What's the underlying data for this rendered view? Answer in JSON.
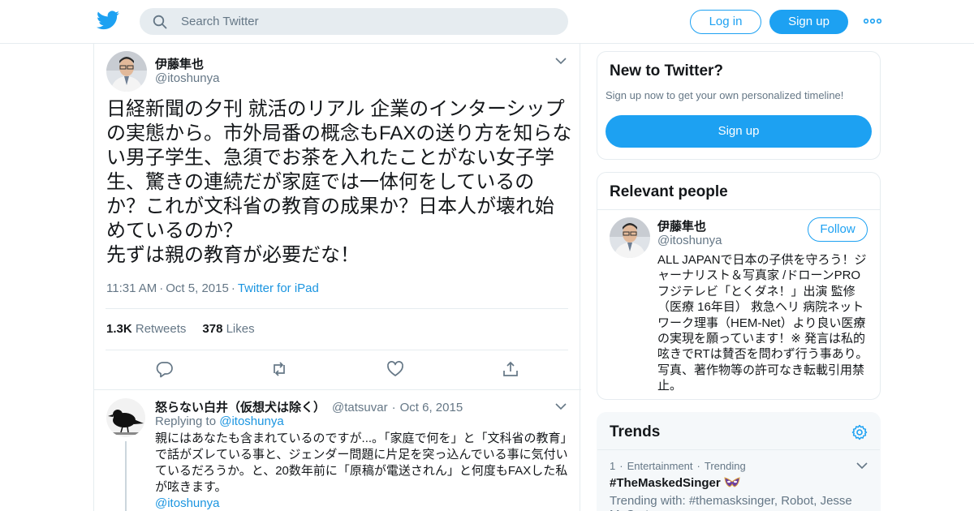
{
  "header": {
    "search_placeholder": "Search Twitter",
    "login_label": "Log in",
    "signup_label": "Sign up"
  },
  "tweet": {
    "name": "伊藤隼也",
    "handle": "@itoshunya",
    "text": "日経新聞の夕刊 就活のリアル 企業のインターシップの実態から。市外局番の概念もFAXの送り方を知らない男子学生、急須でお茶を入れたことがない女子学生、驚きの連続だが家庭では一体何をしているのか？これが文科省の教育の成果か？日本人が壊れ始めているのか？\n先ずは親の教育が必要だな！",
    "time": "11:31 AM",
    "date": "Oct 5, 2015",
    "source": "Twitter for iPad",
    "retweets_count": "1.3K",
    "retweets_label": "Retweets",
    "likes_count": "378",
    "likes_label": "Likes"
  },
  "reply": {
    "name": "怒らない白井（仮想犬は除く）",
    "handle": "@tatsuvar",
    "date": "Oct 6, 2015",
    "replying_prefix": "Replying to",
    "replying_to": "@itoshunya",
    "text": "親にはあなたも含まれているのですが...。「家庭で何を」と「文科省の教育」で話がズレている事と、ジェンダー問題に片足を突っ込んでいる事に気付いているだろうか。と、20数年前に「原稿が電送されん」と何度もFAXした私が呟きます。",
    "mention": "@itoshunya"
  },
  "sidebar": {
    "new_title": "New to Twitter?",
    "new_sub": "Sign up now to get your own personalized timeline!",
    "new_button": "Sign up",
    "relevant_title": "Relevant people",
    "person": {
      "name": "伊藤隼也",
      "handle": "@itoshunya",
      "follow_label": "Follow",
      "bio": "ALL JAPANで日本の子供を守ろう！ジャーナリスト＆写真家 /ドローンPRO フジテレビ「とくダネ！」出演 監修（医療 16年目） 救急ヘリ 病院ネットワーク理事（HEM-Net）より良い医療の実現を願っています！※ 発言は私的呟きでRTは賛否を問わず行う事あり。写真、著作物等の許可なき転載引用禁止。"
    },
    "trends_title": "Trends",
    "trend": {
      "rank": "1",
      "category": "Entertainment",
      "status": "Trending",
      "name": "#TheMaskedSinger",
      "with": "Trending with: #themasksinger, Robot, Jesse McCartney"
    }
  },
  "colors": {
    "accent": "#1da1f2",
    "link": "#1b95e0",
    "muted": "#657786",
    "border": "#e6ecf0"
  }
}
